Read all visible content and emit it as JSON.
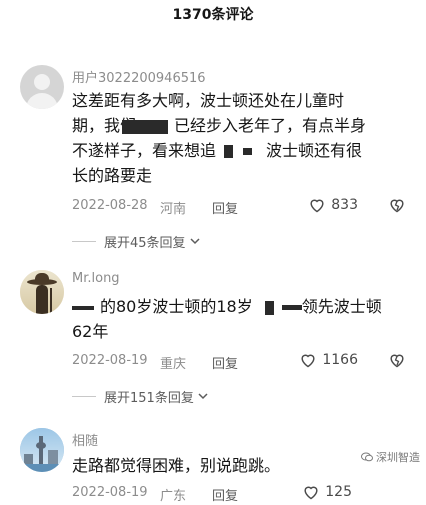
{
  "header": {
    "title": "1370条评论"
  },
  "comments": [
    {
      "username": "用户3022200946516",
      "lines": [
        "这差距有多大啊，波士顿还处在儿童时",
        "期，我们",
        "已经步入老年了，有点半身",
        "不遂样子，看来想追",
        "波士顿还有很",
        "长的路要走"
      ],
      "date": "2022-08-28",
      "region": "河南",
      "reply_label": "回复",
      "likes": "833",
      "expand_label": "展开45条回复"
    },
    {
      "username": "Mr.long",
      "lines": [
        "的80岁波士顿的18岁",
        "领先波士顿",
        "62年"
      ],
      "date": "2022-08-19",
      "region": "重庆",
      "reply_label": "回复",
      "likes": "1166",
      "expand_label": "展开151条回复"
    },
    {
      "username": "相随",
      "lines": [
        "走路都觉得困难，别说跑跳。"
      ],
      "date": "2022-08-19",
      "region": "广东",
      "reply_label": "回复",
      "likes": "125"
    }
  ],
  "watermark": {
    "text": "深圳智造"
  },
  "colors": {
    "text": "#161616",
    "meta": "#8c8c8c",
    "reply": "#5c5c5c",
    "redaction": "#2a2a2a"
  }
}
